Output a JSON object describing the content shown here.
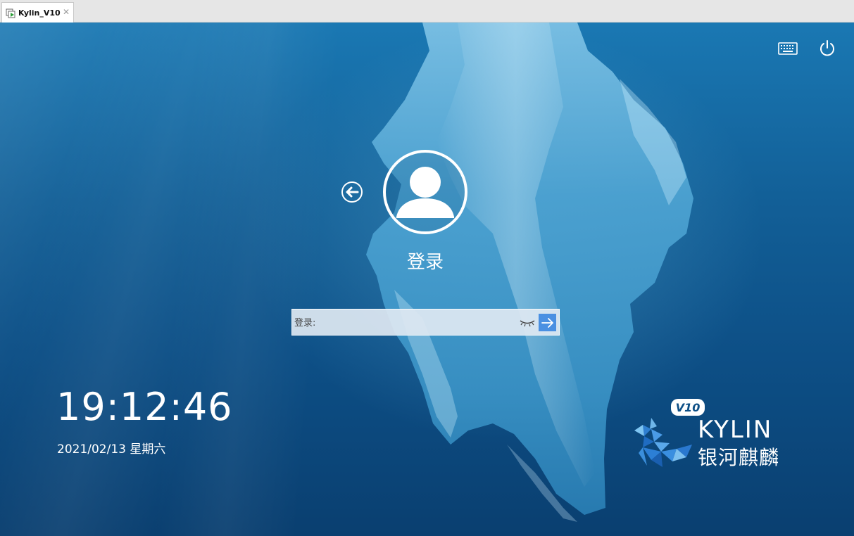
{
  "vm_tab": {
    "label": "Kylin_V10",
    "close_glyph": "✕",
    "icon": "vm-play-icon"
  },
  "topbar": {
    "keyboard_icon": "keyboard-icon",
    "power_icon": "power-icon"
  },
  "login": {
    "back_icon": "back-arrow-icon",
    "avatar_icon": "user-avatar-icon",
    "username": "登录",
    "password_placeholder": "登录:",
    "password_value": "",
    "eye_icon": "eye-closed-icon",
    "submit_icon": "arrow-right-icon"
  },
  "clock": {
    "time": "19:12:46",
    "date": "2021/02/13 星期六"
  },
  "brand": {
    "badge": "V10",
    "wordmark": "KYLIN",
    "chinese": "银河麒麟"
  },
  "colors": {
    "accent": "#4a90e2",
    "background": "#0d4f86",
    "text": "#ffffff"
  }
}
